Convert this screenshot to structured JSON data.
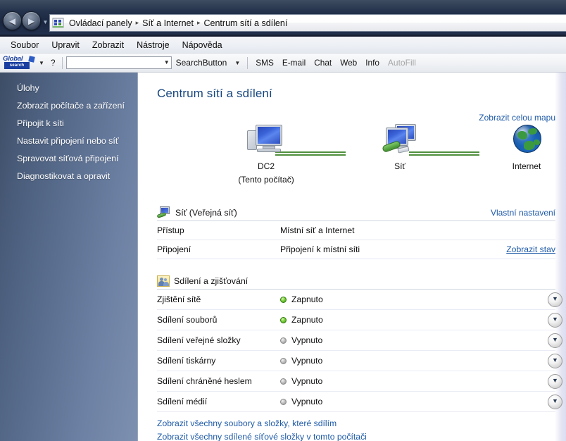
{
  "window": {
    "nav": {
      "back_label": "◀",
      "forward_label": "▶",
      "recent_caret": "▼"
    },
    "breadcrumb": {
      "items": [
        "Ovládací panely",
        "Síť a Internet",
        "Centrum sítí a sdílení"
      ],
      "separator": "▸"
    }
  },
  "menubar": {
    "items": [
      "Soubor",
      "Upravit",
      "Zobrazit",
      "Nástroje",
      "Nápověda"
    ]
  },
  "search_toolbar": {
    "logo_top": "Global",
    "logo_bottom": "search",
    "caret": "▼",
    "help": "?",
    "input_value": "",
    "input_placeholder": "",
    "combo_arrow": "▼",
    "search_button": "SearchButton",
    "search_button_arrow": "▼",
    "links": [
      "SMS",
      "E-mail",
      "Chat",
      "Web",
      "Info"
    ],
    "autofill": "AutoFill"
  },
  "sidebar": {
    "items": [
      {
        "label": "Úlohy"
      },
      {
        "label": "Zobrazit počítače a zařízení"
      },
      {
        "label": "Připojit k síti"
      },
      {
        "label": "Nastavit připojení nebo síť"
      },
      {
        "label": "Spravovat síťová připojení"
      },
      {
        "label": "Diagnostikovat a opravit"
      }
    ]
  },
  "main": {
    "title": "Centrum sítí a sdílení",
    "view_full_map": "Zobrazit celou mapu",
    "network_map": {
      "nodes": [
        {
          "name": "DC2",
          "sublabel": "(Tento počítač)",
          "icon": "computer-icon"
        },
        {
          "name": "Síť",
          "sublabel": "",
          "icon": "network-icon"
        },
        {
          "name": "Internet",
          "sublabel": "",
          "icon": "globe-icon"
        }
      ]
    },
    "network_section": {
      "icon": "network-computer-icon",
      "title": "Síť (Veřejná síť)",
      "action": "Vlastní nastavení",
      "rows": [
        {
          "key": "Přístup",
          "value": "Místní síť a Internet",
          "action": ""
        },
        {
          "key": "Připojení",
          "value": "Připojení k místní síti",
          "action": "Zobrazit stav"
        }
      ]
    },
    "sharing_section": {
      "icon": "people-icon",
      "title": "Sdílení a zjišťování",
      "rows": [
        {
          "label": "Zjištění sítě",
          "status": "Zapnuto",
          "state": "on",
          "expander": "chevron-down-icon"
        },
        {
          "label": "Sdílení souborů",
          "status": "Zapnuto",
          "state": "on",
          "expander": "chevron-down-icon"
        },
        {
          "label": "Sdílení veřejné složky",
          "status": "Vypnuto",
          "state": "off",
          "expander": "chevron-down-icon"
        },
        {
          "label": "Sdílení tiskárny",
          "status": "Vypnuto",
          "state": "off",
          "expander": "chevron-down-icon"
        },
        {
          "label": "Sdílení chráněné heslem",
          "status": "Vypnuto",
          "state": "off",
          "expander": "chevron-down-icon"
        },
        {
          "label": "Sdílení médií",
          "status": "Vypnuto",
          "state": "off",
          "expander": "chevron-down-icon"
        }
      ]
    },
    "bottom_links": [
      "Zobrazit všechny soubory a složky, které sdílím",
      "Zobrazit všechny sdílené síťové složky v tomto počítači"
    ]
  },
  "colors": {
    "accent_link": "#1e5aa8",
    "title_text": "#16457e",
    "status_on": "#7ed13f",
    "status_off": "#c2c2c2"
  }
}
